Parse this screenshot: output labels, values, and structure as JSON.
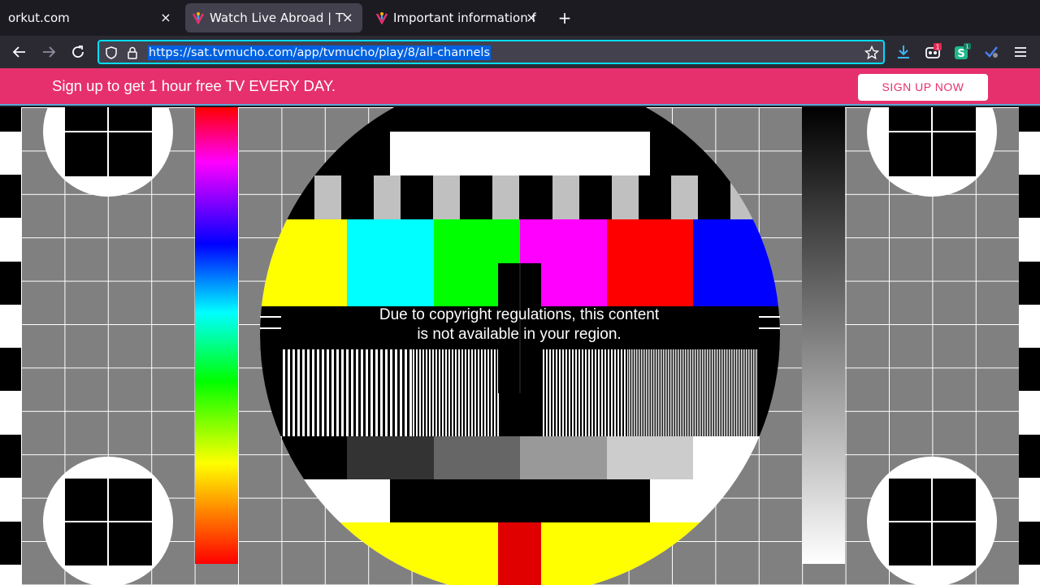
{
  "browser": {
    "tabs": [
      {
        "title": "orkut.com",
        "active": false,
        "close": "×"
      },
      {
        "title": "Watch Live Abroad | TVMucho",
        "active": true,
        "close": "×"
      },
      {
        "title": "Important information for",
        "active": false,
        "close": "×"
      }
    ],
    "new_tab": "+",
    "url": "https://sat.tvmucho.com/app/tvmucho/play/8/all-channels",
    "extension_badges": {
      "first": "1",
      "second": "1"
    }
  },
  "banner": {
    "text": "Sign up to get 1 hour free TV EVERY DAY.",
    "button": "SIGN UP NOW"
  },
  "player": {
    "notice_line1": "Due to copyright regulations, this content",
    "notice_line2": "is not available in your region."
  },
  "colors": {
    "accent": "#e6306e",
    "focus_ring": "#00ddff",
    "selection": "#0061e0"
  }
}
